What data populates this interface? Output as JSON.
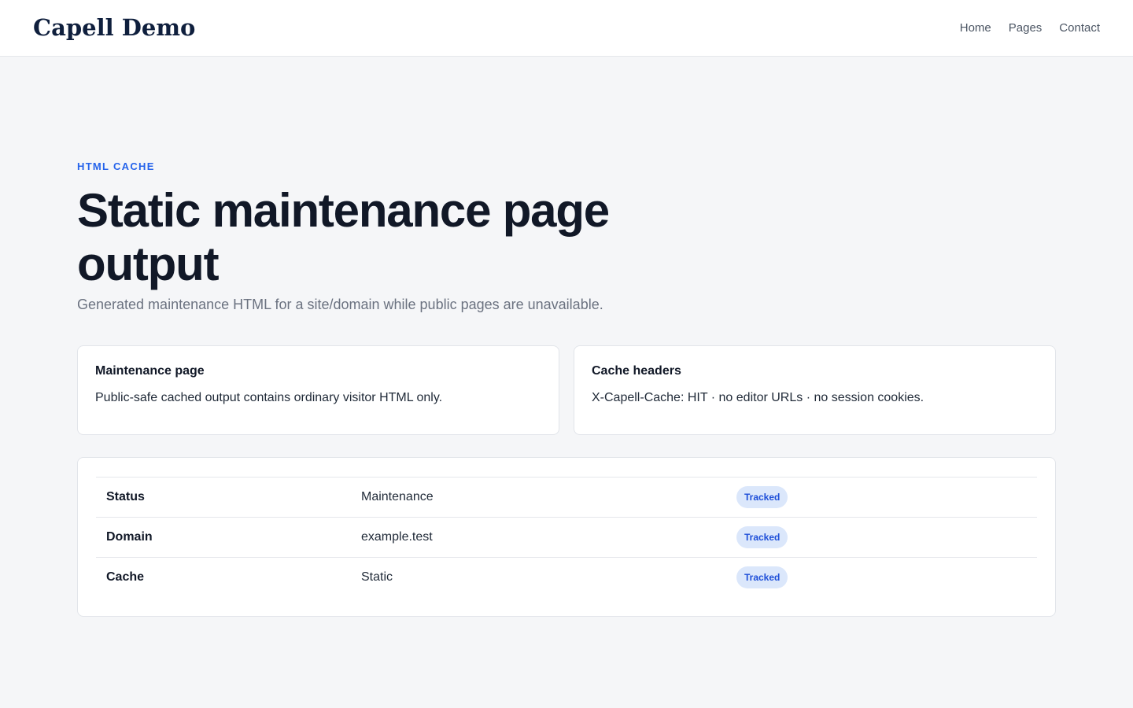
{
  "header": {
    "brand": "Capell Demo",
    "nav": [
      "Home",
      "Pages",
      "Contact"
    ]
  },
  "hero": {
    "eyebrow": "HTML CACHE",
    "title": "Static maintenance page output",
    "subtitle": "Generated maintenance HTML for a site/domain while public pages are unavailable."
  },
  "cards": [
    {
      "title": "Maintenance page",
      "body": "Public-safe cached output contains ordinary visitor HTML only."
    },
    {
      "title": "Cache headers",
      "body": "X-Capell-Cache: HIT · no editor URLs · no session cookies."
    }
  ],
  "table": {
    "rows": [
      {
        "key": "Status",
        "value": "Maintenance",
        "badge": "Tracked"
      },
      {
        "key": "Domain",
        "value": "example.test",
        "badge": "Tracked"
      },
      {
        "key": "Cache",
        "value": "Static",
        "badge": "Tracked"
      }
    ]
  },
  "colors": {
    "accent": "#2563eb",
    "brand": "#0f1f3d",
    "badge_bg": "#dbe7fb",
    "badge_text": "#1d4ed8",
    "page_bg": "#f5f6f8"
  }
}
